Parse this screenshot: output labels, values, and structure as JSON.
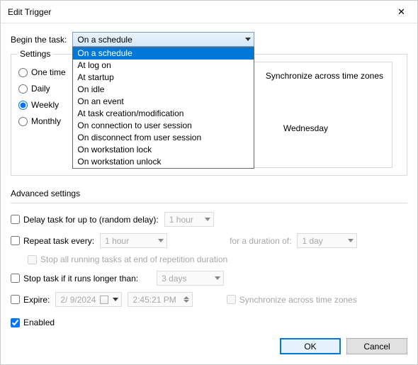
{
  "window": {
    "title": "Edit Trigger",
    "close": "✕"
  },
  "begin": {
    "label": "Begin the task:",
    "selected": "On a schedule",
    "options": [
      "On a schedule",
      "At log on",
      "At startup",
      "On idle",
      "On an event",
      "At task creation/modification",
      "On connection to user session",
      "On disconnect from user session",
      "On workstation lock",
      "On workstation unlock"
    ]
  },
  "settings": {
    "title": "Settings",
    "radios": {
      "one_time": "One time",
      "daily": "Daily",
      "weekly": "Weekly",
      "monthly": "Monthly"
    },
    "selected_radio": "weekly",
    "sync_zones": "Synchronize across time zones",
    "wednesday": "Wednesday"
  },
  "advanced": {
    "title": "Advanced settings",
    "delay_label": "Delay task for up to (random delay):",
    "delay_value": "1 hour",
    "repeat_label": "Repeat task every:",
    "repeat_value": "1 hour",
    "duration_label": "for a duration of:",
    "duration_value": "1 day",
    "stop_all_label": "Stop all running tasks at end of repetition duration",
    "stop_if_label": "Stop task if it runs longer than:",
    "stop_if_value": "3 days",
    "expire_label": "Expire:",
    "expire_date": "2/ 9/2024",
    "expire_time": "2:45:21 PM",
    "sync_zones2": "Synchronize across time zones",
    "enabled_label": "Enabled"
  },
  "buttons": {
    "ok": "OK",
    "cancel": "Cancel"
  }
}
